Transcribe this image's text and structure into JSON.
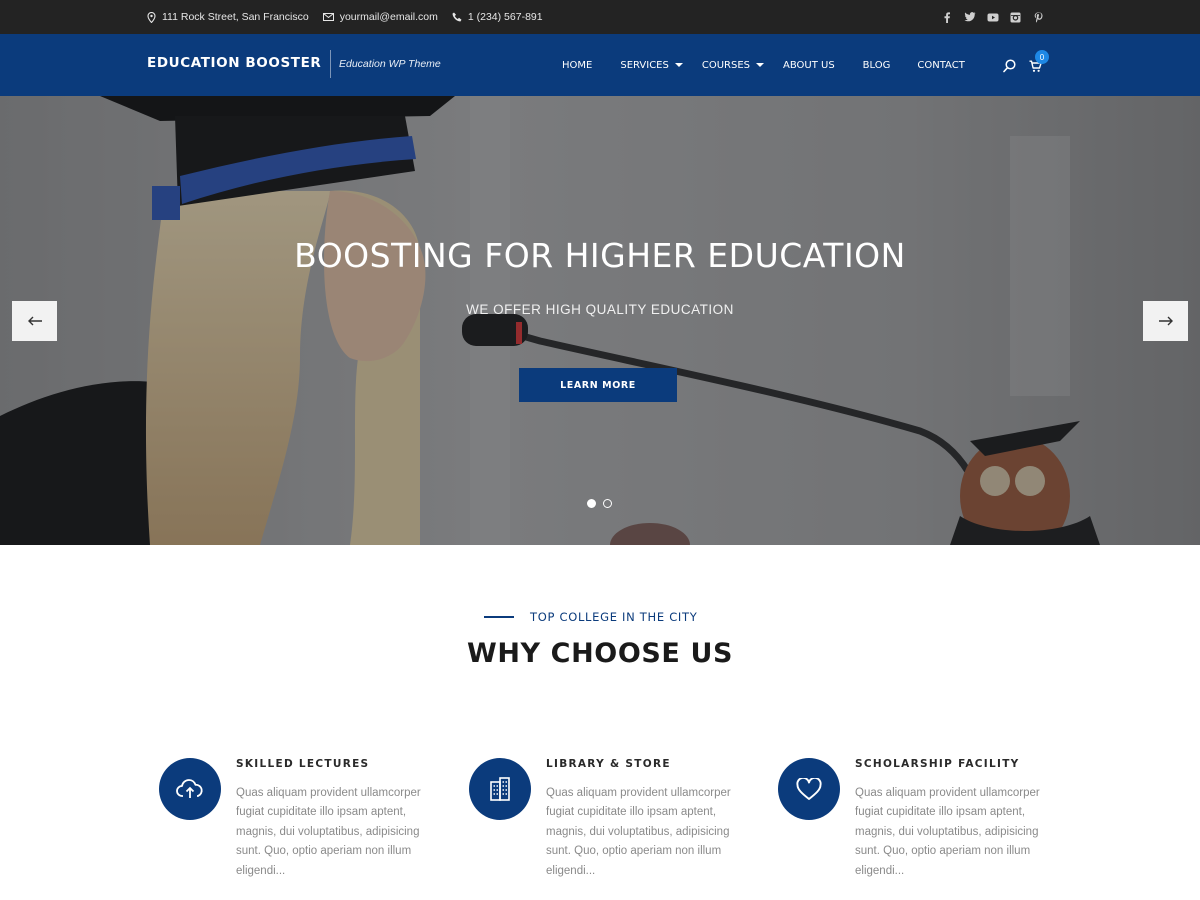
{
  "topbar": {
    "address": "111 Rock Street, San Francisco",
    "email": "yourmail@email.com",
    "phone": "1 (234) 567-891",
    "social": [
      "facebook-icon",
      "twitter-icon",
      "youtube-icon",
      "instagram-icon",
      "pinterest-icon"
    ]
  },
  "header": {
    "logo": "EDUCATION BOOSTER",
    "tagline": "Education WP Theme",
    "nav": [
      "HOME",
      "SERVICES",
      "COURSES",
      "ABOUT US",
      "BLOG",
      "CONTACT"
    ],
    "cart_count": "0"
  },
  "hero": {
    "title": "BOOSTING FOR HIGHER EDUCATION",
    "subtitle": "WE OFFER HIGH QUALITY EDUCATION",
    "button": "LEARN MORE",
    "slides": 2,
    "active_slide": 1
  },
  "why": {
    "eyebrow": "TOP COLLEGE IN THE CITY",
    "title": "WHY CHOOSE US",
    "features": [
      {
        "icon": "cloud-upload-icon",
        "title": "SKILLED LECTURES",
        "text": "Quas aliquam provident ullamcorper fugiat cupiditate illo ipsam aptent, magnis, dui voluptatibus, adipisicing sunt. Quo, optio aperiam non illum eligendi..."
      },
      {
        "icon": "building-icon",
        "title": "LIBRARY & STORE",
        "text": "Quas aliquam provident ullamcorper fugiat cupiditate illo ipsam aptent, magnis, dui voluptatibus, adipisicing sunt. Quo, optio aperiam non illum eligendi..."
      },
      {
        "icon": "heart-icon",
        "title": "SCHOLARSHIP FACILITY",
        "text": "Quas aliquam provident ullamcorper fugiat cupiditate illo ipsam aptent, magnis, dui voluptatibus, adipisicing sunt. Quo, optio aperiam non illum eligendi..."
      }
    ]
  },
  "colors": {
    "brand": "#0b3b7c",
    "topbar": "#232323",
    "badge": "#1e88e5"
  }
}
